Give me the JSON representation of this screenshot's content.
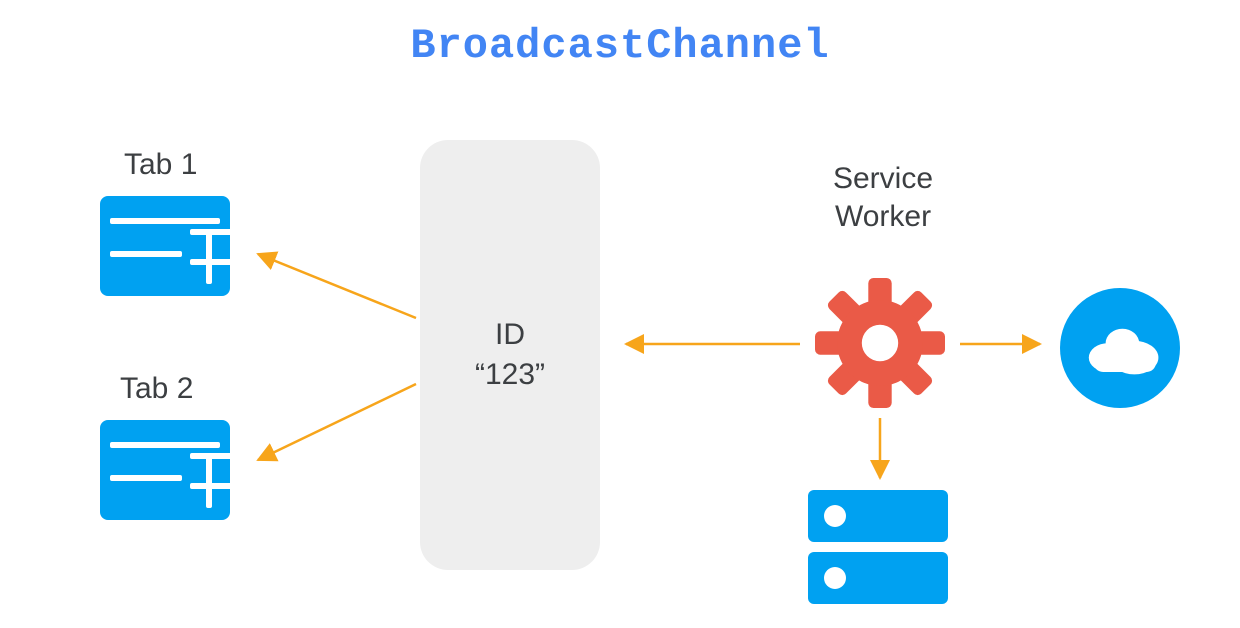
{
  "title": "BroadcastChannel",
  "tabs": [
    {
      "label": "Tab 1",
      "icon": "browser-window-icon"
    },
    {
      "label": "Tab 2",
      "icon": "browser-window-icon"
    }
  ],
  "channel": {
    "id_label": "ID",
    "id_value": "“123”"
  },
  "service_worker": {
    "label_line1": "Service",
    "label_line2": "Worker",
    "icon": "gear-icon"
  },
  "cloud": {
    "icon": "cloud-icon"
  },
  "storage": {
    "icon": "server-stack-icon"
  },
  "colors": {
    "brand_blue": "#4285F4",
    "icon_blue": "#00A1F1",
    "gear_red": "#EA5A47",
    "arrow": "#F7A51B",
    "pill_bg": "#EEEEEE",
    "text": "#3C3F42"
  },
  "arrows": [
    {
      "from": "channel",
      "to": "tab-1"
    },
    {
      "from": "channel",
      "to": "tab-2"
    },
    {
      "from": "service-worker",
      "to": "channel"
    },
    {
      "from": "service-worker",
      "to": "cloud"
    },
    {
      "from": "service-worker",
      "to": "storage"
    }
  ]
}
